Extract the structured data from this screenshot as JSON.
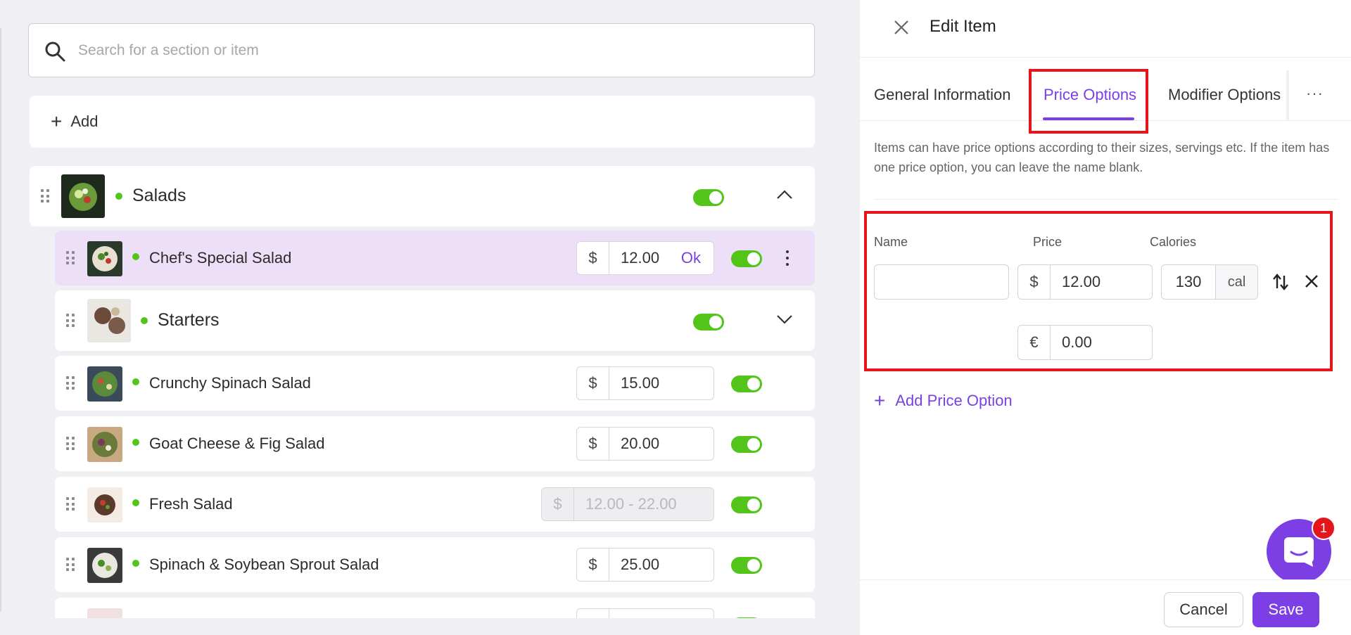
{
  "search": {
    "placeholder": "Search for a section or item"
  },
  "add_bar": {
    "label": "Add"
  },
  "sections": {
    "salads": {
      "label": "Salads"
    },
    "starters": {
      "label": "Starters"
    }
  },
  "items": [
    {
      "label": "Chef's Special Salad",
      "currency": "$",
      "price": "12.00",
      "ok_label": "Ok"
    },
    {
      "label": "Crunchy Spinach Salad",
      "currency": "$",
      "price": "15.00"
    },
    {
      "label": "Goat Cheese & Fig Salad",
      "currency": "$",
      "price": "20.00"
    },
    {
      "label": "Fresh Salad",
      "currency": "$",
      "price": "12.00 - 22.00"
    },
    {
      "label": "Spinach & Soybean Sprout Salad",
      "currency": "$",
      "price": "25.00"
    },
    {
      "label": "",
      "currency": "$",
      "price": ""
    }
  ],
  "panel": {
    "title": "Edit Item",
    "tabs": [
      "General Information",
      "Price Options",
      "Modifier Options"
    ],
    "active_tab": "Price Options",
    "more_label": "···",
    "description": "Items can have price options according to their sizes, servings etc. If the item has one price option, you can leave the name blank.",
    "price_option": {
      "name_label": "Name",
      "price_label": "Price",
      "calories_label": "Calories",
      "name_value": "",
      "currency_1": "$",
      "price_1": "12.00",
      "calories_value": "130",
      "calories_unit": "cal",
      "currency_2": "€",
      "price_2": "0.00"
    },
    "add_price_option_label": "Add Price Option",
    "cancel_label": "Cancel",
    "save_label": "Save"
  },
  "chat": {
    "badge_count": "1"
  },
  "colors": {
    "accent": "#7b3fe4",
    "toggle_on": "#52c41a",
    "highlight": "#e4151b",
    "selected_row": "#eedff9"
  }
}
